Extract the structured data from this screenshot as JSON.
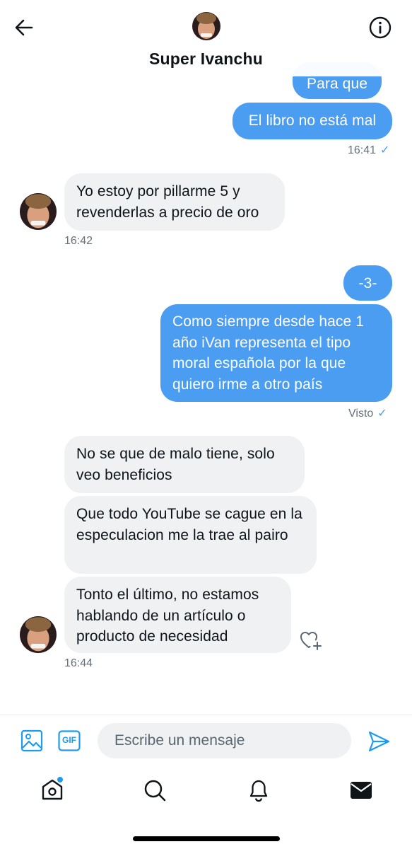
{
  "header": {
    "name": "Super Ivanchu",
    "back_icon": "arrow-left-icon",
    "info_icon": "info-circle-icon"
  },
  "colors": {
    "sent_bubble": "#4a9df0",
    "received_bubble": "#eff1f3",
    "accent": "#1d9bf0"
  },
  "messages": [
    {
      "direction": "sent",
      "text": "Para que ?"
    },
    {
      "direction": "sent",
      "text": "El libro no está mal"
    },
    {
      "meta": "16:41"
    },
    {
      "direction": "received",
      "text": "Yo estoy por pillarme 5 y revenderlas a precio de oro"
    },
    {
      "meta": "16:42"
    },
    {
      "direction": "sent",
      "text": "-3-"
    },
    {
      "direction": "sent",
      "text": "Como siempre desde hace 1 año iVan representa el tipo moral española por la que quiero irme a otro país"
    },
    {
      "meta": "Visto"
    },
    {
      "direction": "received",
      "text": "No se que de malo tiene, solo veo beneficios"
    },
    {
      "direction": "received",
      "text": "Que todo YouTube se cague en la especulacion me la trae al pairo"
    },
    {
      "direction": "received",
      "text": "Tonto el último, no estamos hablando de un artículo o producto de necesidad"
    },
    {
      "meta": "16:44"
    }
  ],
  "composer": {
    "placeholder": "Escribe un mensaje",
    "gif_label": "GIF"
  },
  "tabbar": {
    "items": [
      "home-icon",
      "search-icon",
      "bell-icon",
      "mail-icon"
    ],
    "active": "mail-icon"
  }
}
